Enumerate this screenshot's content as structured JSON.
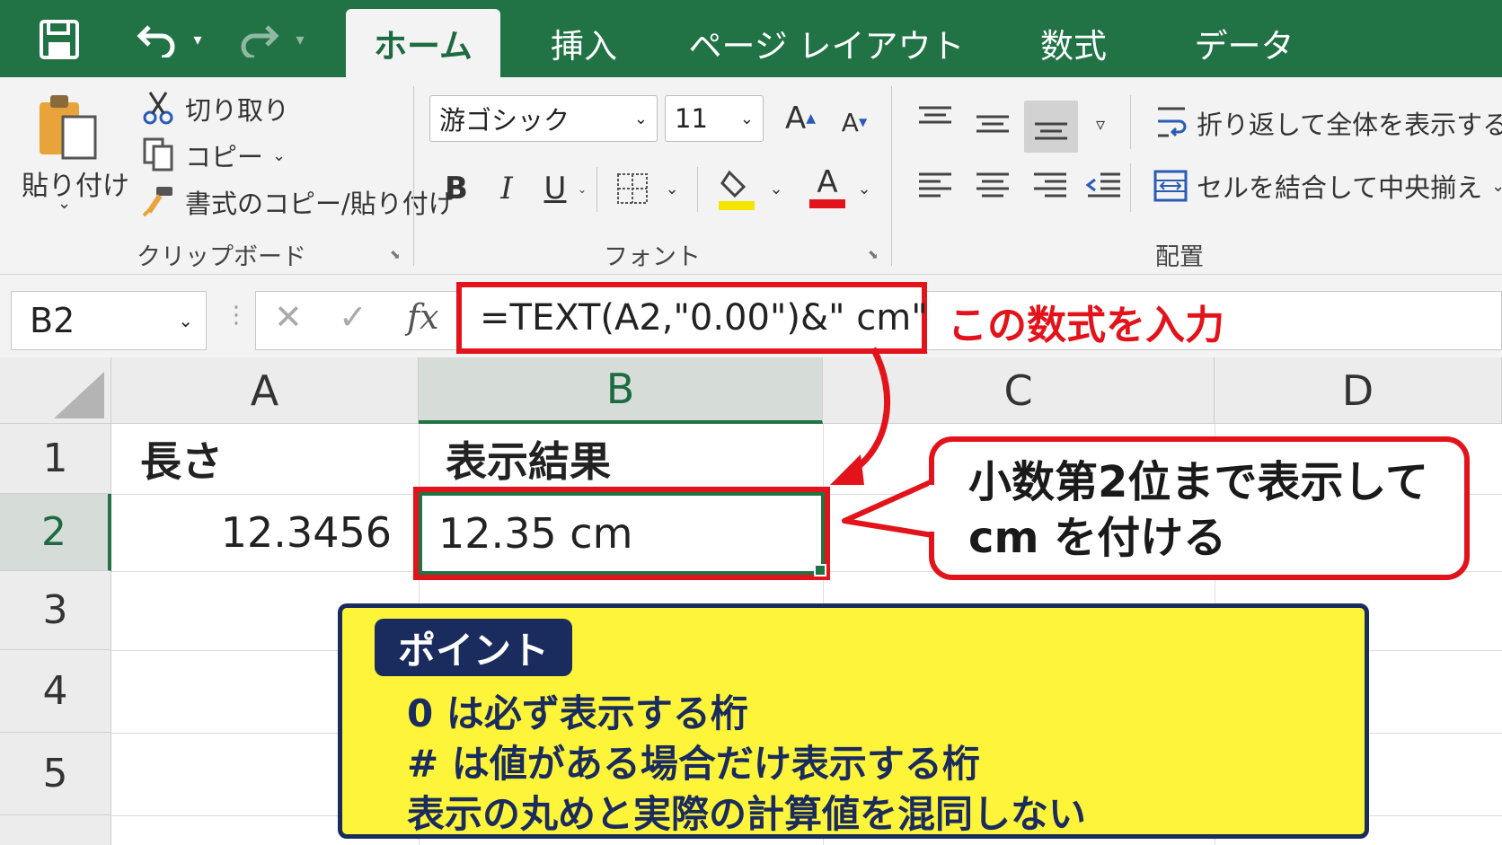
{
  "tabs": [
    {
      "label": "ホーム",
      "active": true
    },
    {
      "label": "挿入",
      "active": false
    },
    {
      "label": "ページ レイアウト",
      "active": false
    },
    {
      "label": "数式",
      "active": false
    },
    {
      "label": "データ",
      "active": false
    }
  ],
  "ribbon": {
    "clipboard": {
      "paste": "貼り付け",
      "cut": "切り取り",
      "copy": "コピー",
      "format_painter": "書式のコピー/貼り付け",
      "group_label": "クリップボード"
    },
    "font": {
      "font_name": "游ゴシック",
      "font_size": "11",
      "bold": "B",
      "italic": "I",
      "underline": "U",
      "font_color_glyph": "A",
      "group_label": "フォント",
      "highlight_color": "#f5e600",
      "font_color": "#e3131b"
    },
    "alignment": {
      "wrap_text": "折り返して全体を表示する",
      "merge_center": "セルを結合して中央揃え",
      "group_label": "配置"
    }
  },
  "formula_bar": {
    "name_box": "B2",
    "fx": "fx",
    "formula": "=TEXT(A2,\"0.00\")&\" cm\"",
    "annotation": "この数式を入力"
  },
  "sheet": {
    "columns": [
      "A",
      "B",
      "C",
      "D"
    ],
    "rows": [
      "1",
      "2",
      "3",
      "4",
      "5"
    ],
    "cells": {
      "A1": "長さ",
      "B1": "表示結果",
      "A2": "12.3456",
      "B2": "12.35 cm"
    },
    "selected_cell": "B2"
  },
  "callout": {
    "line1": "小数第2位まで表示して",
    "line2": "cm を付ける"
  },
  "point_box": {
    "title": "ポイント",
    "lines": [
      "0 は必ず表示する桁",
      "# は値がある場合だけ表示する桁",
      "表示の丸めと実際の計算値を混同しない"
    ]
  },
  "colors": {
    "excel_green": "#217346",
    "accent_red": "#e3131b",
    "point_yellow": "#fef43a",
    "point_navy": "#1a2b5e"
  }
}
